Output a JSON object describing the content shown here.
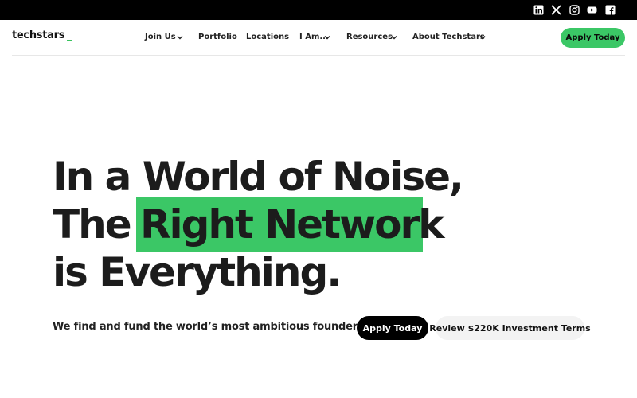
{
  "topbar": {
    "social_icons": [
      "linkedin-icon",
      "x-icon",
      "instagram-icon",
      "youtube-icon",
      "facebook-icon"
    ]
  },
  "header": {
    "logo": "techstars",
    "nav": [
      {
        "label": "Join Us",
        "has_dropdown": true
      },
      {
        "label": "Portfolio",
        "has_dropdown": false
      },
      {
        "label": "Locations",
        "has_dropdown": false
      },
      {
        "label": "I Am...",
        "has_dropdown": true
      },
      {
        "label": "Resources",
        "has_dropdown": true
      },
      {
        "label": "About Techstars",
        "has_dropdown": true
      }
    ],
    "apply_label": "Apply Today"
  },
  "hero": {
    "line1": "In a World of Noise,",
    "line2_prefix": "The",
    "line2_highlight": "Right Network",
    "line3": "is Everything.",
    "tagline": "We find and fund the world’s most ambitious founders.",
    "apply_label": "Apply Today",
    "review_label": "Review $220K Investment Terms"
  },
  "colors": {
    "accent": "#3bc766",
    "topbar": "#000000",
    "text": "#1c1c1c"
  }
}
